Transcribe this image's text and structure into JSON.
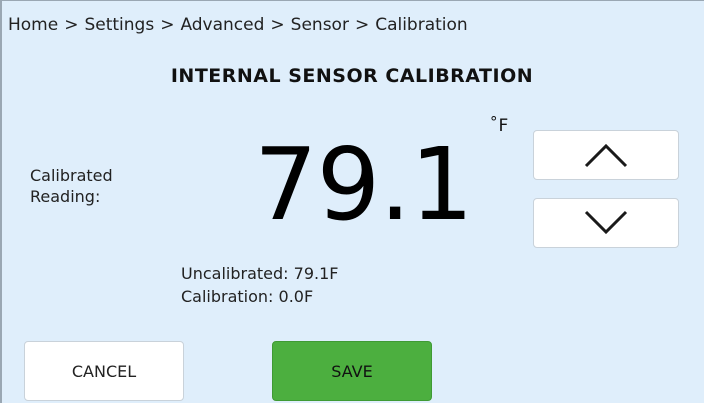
{
  "breadcrumb": {
    "items": [
      "Home",
      "Settings",
      "Advanced",
      "Sensor",
      "Calibration"
    ],
    "separator": ">"
  },
  "title": "INTERNAL SENSOR CALIBRATION",
  "reading": {
    "label_line1": "Calibrated",
    "label_line2": "Reading:",
    "value": "79.1",
    "unit_symbol": "°",
    "unit": "F"
  },
  "stepper": {
    "up_icon": "chevron-up-icon",
    "down_icon": "chevron-down-icon"
  },
  "info": {
    "uncalibrated": "Uncalibrated: 79.1F",
    "calibration": "Calibration: 0.0F"
  },
  "actions": {
    "cancel_label": "CANCEL",
    "save_label": "SAVE"
  },
  "colors": {
    "background": "#dfeefb",
    "save_button": "#4caf3f",
    "button_white": "#ffffff"
  }
}
